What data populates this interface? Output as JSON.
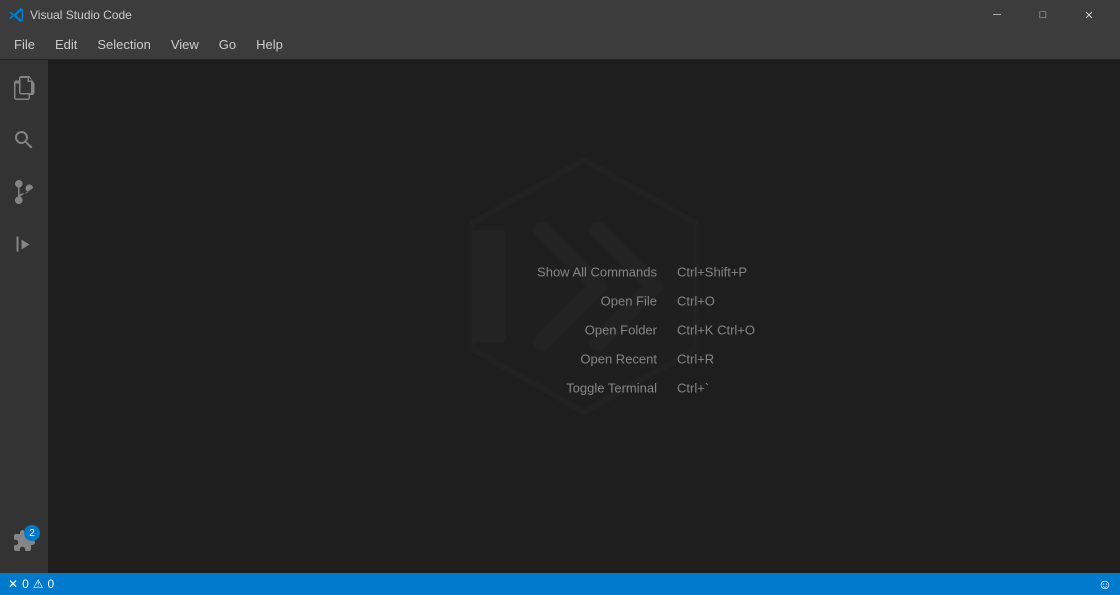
{
  "titlebar": {
    "icon": "⬛",
    "title": "Visual Studio Code",
    "min_label": "─",
    "max_label": "□",
    "close_label": "✕"
  },
  "menubar": {
    "items": [
      {
        "id": "file",
        "label": "File"
      },
      {
        "id": "edit",
        "label": "Edit"
      },
      {
        "id": "selection",
        "label": "Selection"
      },
      {
        "id": "view",
        "label": "View"
      },
      {
        "id": "go",
        "label": "Go"
      },
      {
        "id": "help",
        "label": "Help"
      }
    ]
  },
  "activitybar": {
    "icons": [
      {
        "id": "explorer",
        "icon": "⎘",
        "active": false,
        "badge": null
      },
      {
        "id": "search",
        "icon": "⌕",
        "active": false,
        "badge": null
      },
      {
        "id": "source-control",
        "icon": "⎇",
        "active": false,
        "badge": null
      },
      {
        "id": "extensions",
        "icon": "⊞",
        "active": false,
        "badge": "2"
      }
    ]
  },
  "shortcuts": [
    {
      "id": "show-all-commands",
      "label": "Show All Commands",
      "key": "Ctrl+Shift+P"
    },
    {
      "id": "open-file",
      "label": "Open File",
      "key": "Ctrl+O"
    },
    {
      "id": "open-folder",
      "label": "Open Folder",
      "key": "Ctrl+K Ctrl+O"
    },
    {
      "id": "open-recent",
      "label": "Open Recent",
      "key": "Ctrl+R"
    },
    {
      "id": "toggle-terminal",
      "label": "Toggle Terminal",
      "key": "Ctrl+`"
    }
  ],
  "statusbar": {
    "errors": "0",
    "warnings": "0",
    "smiley": "☺",
    "error_icon": "✕",
    "warning_icon": "⚠"
  }
}
